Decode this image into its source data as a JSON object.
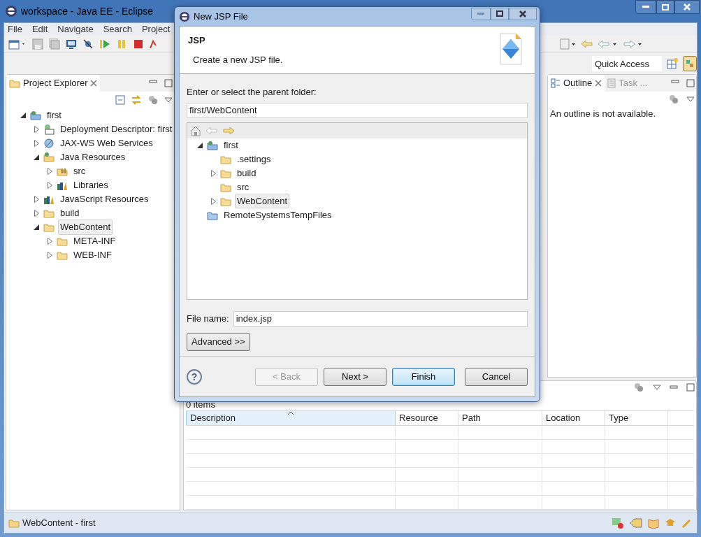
{
  "window": {
    "title": "workspace - Java EE - Eclipse"
  },
  "menu_bar": [
    "File",
    "Edit",
    "Navigate",
    "Search",
    "Project"
  ],
  "quick_access": {
    "placeholder": "Quick Access"
  },
  "project_explorer": {
    "tab": {
      "label": "Project Explorer",
      "selected": true
    },
    "tree": [
      {
        "label": "first",
        "kind": "project",
        "expanded": true,
        "selected": false,
        "children": [
          {
            "label": "Deployment Descriptor: first",
            "kind": "descriptor",
            "expanded": false,
            "selected": false
          },
          {
            "label": "JAX-WS Web Services",
            "kind": "webservice",
            "expanded": false,
            "selected": false
          },
          {
            "label": "Java Resources",
            "kind": "java",
            "expanded": true,
            "selected": false,
            "children": [
              {
                "label": "src",
                "kind": "package",
                "expanded": false,
                "selected": false
              },
              {
                "label": "Libraries",
                "kind": "library",
                "expanded": false,
                "selected": false
              }
            ]
          },
          {
            "label": "JavaScript Resources",
            "kind": "library",
            "expanded": false,
            "selected": false
          },
          {
            "label": "build",
            "kind": "folder",
            "expanded": false,
            "selected": false
          },
          {
            "label": "WebContent",
            "kind": "folder",
            "expanded": true,
            "selected": true,
            "children": [
              {
                "label": "META-INF",
                "kind": "folder",
                "expanded": false,
                "selected": false
              },
              {
                "label": "WEB-INF",
                "kind": "folder",
                "expanded": false,
                "selected": false
              }
            ]
          }
        ]
      }
    ]
  },
  "outline": {
    "tabs": [
      {
        "label": "Outline",
        "selected": true
      },
      {
        "label": "Task ...",
        "selected": false
      }
    ],
    "message": "An outline is not available."
  },
  "problems": {
    "count": "0 items",
    "columns": [
      {
        "label": "Description",
        "sorted": true
      },
      {
        "label": "Resource",
        "sorted": false
      },
      {
        "label": "Path",
        "sorted": false
      },
      {
        "label": "Location",
        "sorted": false
      },
      {
        "label": "Type",
        "sorted": false
      }
    ]
  },
  "status_bar": {
    "text": "WebContent - first"
  },
  "dialog": {
    "title": "New JSP File",
    "heading": "JSP",
    "description": "Create a new JSP file.",
    "folder_label": "Enter or select the parent folder:",
    "folder_value": "first/WebContent",
    "tree": [
      {
        "label": "first",
        "kind": "project",
        "expanded": true,
        "selected": false,
        "children": [
          {
            "label": ".settings",
            "kind": "folder",
            "selected": false
          },
          {
            "label": "build",
            "kind": "folder",
            "expanded": false,
            "selected": false
          },
          {
            "label": "src",
            "kind": "folder",
            "selected": false
          },
          {
            "label": "WebContent",
            "kind": "folder",
            "expanded": false,
            "selected": true
          }
        ]
      },
      {
        "label": "RemoteSystemsTempFiles",
        "kind": "remote",
        "selected": false
      }
    ],
    "file_name_label": "File name:",
    "file_name_value": "index.jsp",
    "advanced_button": "Advanced >>",
    "help": "?",
    "buttons": [
      {
        "label": "< Back",
        "disabled": true,
        "default": false
      },
      {
        "label": "Next >",
        "disabled": false,
        "default": false
      },
      {
        "label": "Finish",
        "disabled": false,
        "default": true
      },
      {
        "label": "Cancel",
        "disabled": false,
        "default": false
      }
    ]
  }
}
